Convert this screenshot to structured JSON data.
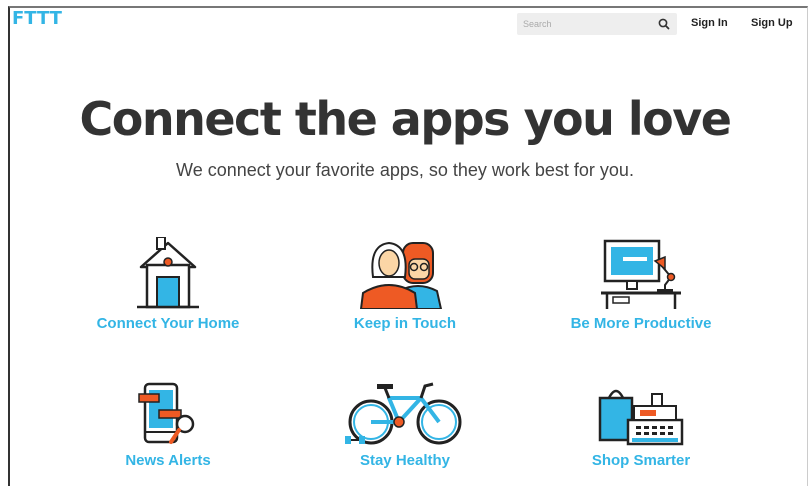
{
  "header": {
    "logo_text": "FTTT",
    "search_placeholder": "Search",
    "sign_in": "Sign In",
    "sign_up": "Sign Up"
  },
  "hero": {
    "title": "Connect the apps you love",
    "subtitle": "We connect your favorite apps, so they work best for you."
  },
  "categories": [
    {
      "label": "Connect Your Home",
      "icon": "house-icon"
    },
    {
      "label": "Keep in Touch",
      "icon": "couple-icon"
    },
    {
      "label": "Be More Productive",
      "icon": "desk-computer-icon"
    },
    {
      "label": "News Alerts",
      "icon": "phone-news-icon"
    },
    {
      "label": "Stay Healthy",
      "icon": "bicycle-icon"
    },
    {
      "label": "Shop Smarter",
      "icon": "shopping-register-icon"
    }
  ],
  "colors": {
    "accent": "#33b5e5",
    "orange": "#ee5a24",
    "dark": "#333333"
  }
}
